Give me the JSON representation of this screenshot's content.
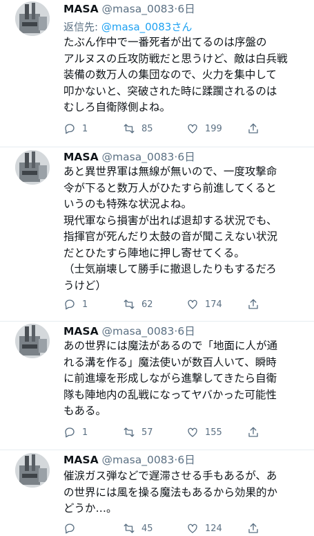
{
  "tweets": [
    {
      "name": "MASA",
      "handle": "@masa_0083",
      "sep": "·",
      "date": "6日",
      "reply_prefix": "返信先: ",
      "reply_to": "@masa_0083さん",
      "lines": [
        "たぶん作中で一番死者が出てるのは序盤の",
        "アルヌスの丘攻防戦だと思うけど、敵は白兵戦",
        "装備の数万人の集団なので、火力を集中して",
        "叩かないと、突破された時に蹂躙されるのは",
        "むしろ自衛隊側よね。"
      ],
      "replies": "1",
      "retweets": "85",
      "likes": "199"
    },
    {
      "name": "MASA",
      "handle": "@masa_0083",
      "sep": "·",
      "date": "6日",
      "lines": [
        "あと異世界軍は無線が無いので、一度攻撃命",
        "令が下ると数万人がひたすら前進してくると",
        "いうのも特殊な状況よね。",
        "現代軍なら損害が出れば退却する状況でも、",
        "指揮官が死んだり太鼓の音が聞こえない状況",
        "だとひたすら陣地に押し寄せてくる。",
        "（士気崩壊して勝手に撤退したりもするだろ",
        "うけど）"
      ],
      "replies": "1",
      "retweets": "62",
      "likes": "174"
    },
    {
      "name": "MASA",
      "handle": "@masa_0083",
      "sep": "·",
      "date": "6日",
      "lines": [
        "あの世界には魔法があるので「地面に人が通",
        "れる溝を作る」魔法使いが数百人いて、瞬時",
        "に前進壕を形成しながら進撃してきたら自衛",
        "隊も陣地内の乱戦になってヤバかった可能性",
        "もある。"
      ],
      "replies": "1",
      "retweets": "57",
      "likes": "155"
    },
    {
      "name": "MASA",
      "handle": "@masa_0083",
      "sep": "·",
      "date": "6日",
      "lines": [
        "催涙ガス弾などで遅滞させる手もあるが、あ",
        "の世界には風を操る魔法もあるから効果的か",
        "どうか…。"
      ],
      "replies": "",
      "retweets": "45",
      "likes": "124"
    }
  ]
}
